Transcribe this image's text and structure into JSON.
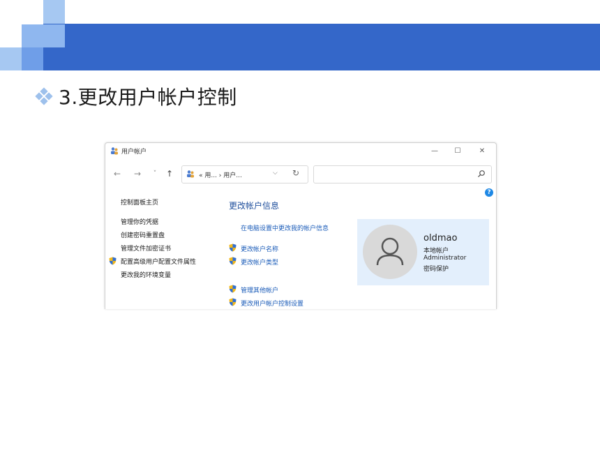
{
  "slide": {
    "title": "3.更改用户帐户控制",
    "colors": {
      "band": "#3467c9",
      "light_square": "#a6c8f2",
      "bullet": "#9ec1ec"
    }
  },
  "window": {
    "title": "用户帐户",
    "controls": {
      "minimize": "—",
      "maximize": "☐",
      "close": "✕"
    },
    "nav": {
      "back": "←",
      "forward": "→",
      "recent": "˅",
      "up": "↑"
    },
    "address": {
      "breadcrumb": "« 用... › 用户...",
      "dropdown": "⌵",
      "refresh": "↻"
    },
    "search": {
      "placeholder": ""
    }
  },
  "sidebar": {
    "items": [
      {
        "label": "控制面板主页",
        "shield": false
      },
      {
        "label": "管理你的凭据",
        "shield": false
      },
      {
        "label": "创建密码重置盘",
        "shield": false
      },
      {
        "label": "管理文件加密证书",
        "shield": false
      },
      {
        "label": "配置高级用户配置文件属性",
        "shield": true
      },
      {
        "label": "更改我的环境变量",
        "shield": false
      }
    ]
  },
  "main": {
    "heading": "更改帐户信息",
    "links": [
      {
        "label": "在电脑设置中更改我的帐户信息",
        "shield": false
      },
      {
        "label": "更改帐户名称",
        "shield": true
      },
      {
        "label": "更改帐户类型",
        "shield": true
      },
      {
        "label": "管理其他帐户",
        "shield": true
      },
      {
        "label": "更改用户帐户控制设置",
        "shield": true
      }
    ],
    "help": "?"
  },
  "user": {
    "name": "oldmao",
    "account_type": "本地帐户",
    "group": "Administrator",
    "password": "密码保护"
  }
}
